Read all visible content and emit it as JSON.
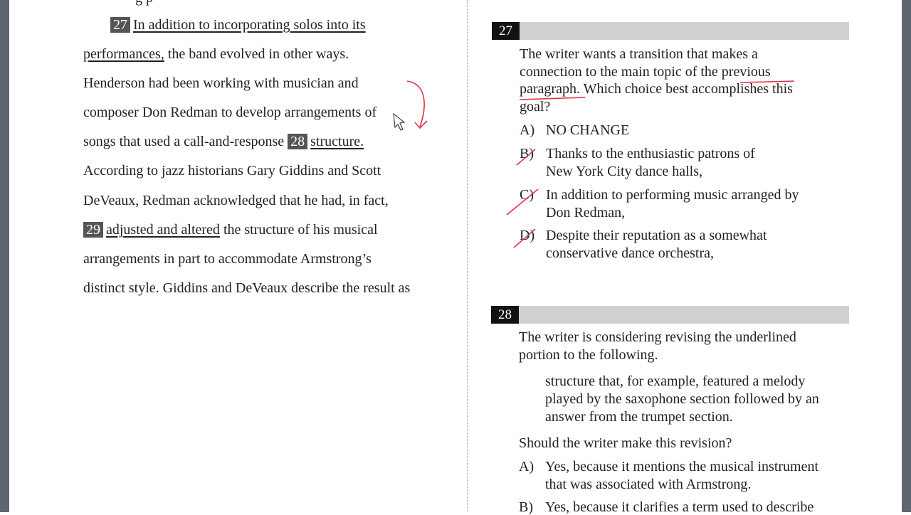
{
  "passage": {
    "top_fragment": "g          p",
    "lines": [
      {
        "num": "27",
        "u": "In addition to incorporating solos into its",
        "rest": ""
      },
      {
        "u": "performances,",
        "rest": " the band evolved in other ways."
      },
      {
        "text": "Henderson had been working with musician and"
      },
      {
        "text": "composer Don Redman to develop arrangements of"
      },
      {
        "pre": "songs that used a call-and-response ",
        "num": "28",
        "u": "structure."
      },
      {
        "text": "According to jazz historians Gary Giddins and Scott"
      },
      {
        "text": "DeVeaux, Redman acknowledged that he had, in fact,"
      },
      {
        "num": "29",
        "u": "adjusted and altered",
        "rest": " the structure of his musical"
      },
      {
        "text": "arrangements in part to accommodate Armstrong’s"
      },
      {
        "text": "distinct style. Giddins and DeVeaux describe the result as"
      }
    ]
  },
  "q27": {
    "number": "27",
    "stem": [
      "The writer wants a transition that makes a",
      "connection to the main topic of the previous",
      "paragraph. Which choice best accomplishes this",
      "goal?"
    ],
    "options": [
      {
        "letter": "A)",
        "lines": [
          "NO CHANGE"
        ]
      },
      {
        "letter": "B)",
        "lines": [
          "Thanks to the enthusiastic patrons of",
          "New York City dance halls,"
        ]
      },
      {
        "letter": "C)",
        "lines": [
          "In addition to performing music arranged by",
          "Don Redman,"
        ]
      },
      {
        "letter": "D)",
        "lines": [
          "Despite their reputation as a somewhat",
          "conservative dance orchestra,"
        ]
      }
    ]
  },
  "q28": {
    "number": "28",
    "stem": [
      "The writer is considering revising the underlined",
      "portion to the following."
    ],
    "quote": [
      "structure that, for example, featured a melody",
      "played by the saxophone section followed by an",
      "answer from the trumpet section."
    ],
    "question": "Should the writer make this revision?",
    "options": [
      {
        "letter": "A)",
        "lines": [
          "Yes, because it mentions the musical instrument",
          "that was associated with Armstrong."
        ]
      },
      {
        "letter": "B)",
        "lines": [
          "Yes, because it clarifies a term used to describe"
        ]
      }
    ]
  },
  "colors": {
    "annotation": "#e0314a",
    "number_box": "#555555",
    "header_bar": "#d0d0d0"
  }
}
